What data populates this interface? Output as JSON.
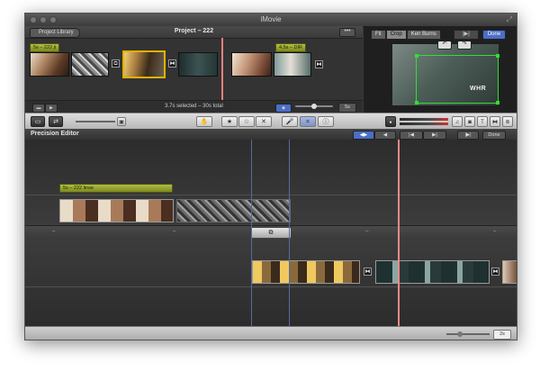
{
  "window": {
    "title": "iMovie",
    "resize_glyph": "⤢"
  },
  "project": {
    "library_button": "Project Library",
    "name": "Project – 222",
    "more_button": "•••",
    "clip_tag_1": "5s – 222 ji",
    "clip_tag_2": "4.5s – DIR",
    "selection_info": "3.7s selected – 30s total",
    "duration_button": "5s"
  },
  "viewer": {
    "tabs": [
      "Fit",
      "Crop",
      "Ken Burns"
    ],
    "active_tab": "Crop",
    "play_button": "|▶|",
    "done_button": "Done",
    "rotate_left": "↶",
    "rotate_right": "↷",
    "frame_text": "WHR"
  },
  "toolbar": {
    "hand_icon": "✋",
    "favorite_icon": "★",
    "unfavorite_icon": "☆",
    "reject_icon": "✕",
    "voiceover_icon": "🎤",
    "crop_icon": "⌗",
    "info_icon": "ⓘ"
  },
  "precision_editor": {
    "title": "Precision Editor",
    "button_1": "◀▶",
    "button_2": "◀",
    "button_3": "|◀",
    "button_4": "▶|",
    "play_button": "|▶|",
    "done_button": "Done",
    "clip_tag": "5s – 222 linse",
    "transition_glyph": "⧉",
    "zoom_label": "2s"
  },
  "colors": {
    "playhead": "#e98080",
    "selection": "#e0b000",
    "tag_green": "#9aa636",
    "crop_green": "#33dd33",
    "done_blue": "#4b6fc7"
  }
}
